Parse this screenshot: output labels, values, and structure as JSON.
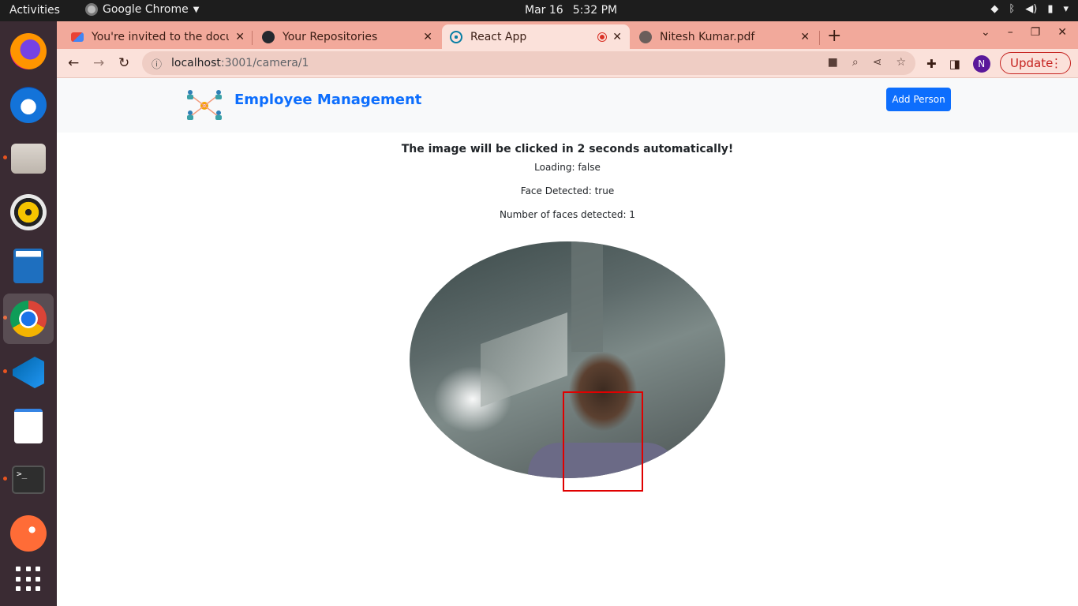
{
  "system": {
    "activities": "Activities",
    "app_name": "Google Chrome",
    "date": "Mar 16",
    "time": "5:32 PM"
  },
  "dock": {
    "apps": [
      "firefox-icon",
      "thunderbird-icon",
      "files-icon",
      "rhythmbox-icon",
      "libreoffice-writer-icon",
      "chrome-icon",
      "vscode-icon",
      "text-editor-icon",
      "terminal-icon",
      "postman-icon",
      "show-apps-icon"
    ]
  },
  "tabs": [
    {
      "title": "You're invited to the docu",
      "favicon": "gmail-icon",
      "active": false
    },
    {
      "title": "Your Repositories",
      "favicon": "github-icon",
      "active": false
    },
    {
      "title": "React App",
      "favicon": "react-icon",
      "active": true
    },
    {
      "title": "Nitesh Kumar.pdf",
      "favicon": "globe-icon",
      "active": false
    }
  ],
  "toolbar": {
    "url_host": "localhost",
    "url_path": ":3001/camera/1",
    "avatar_letter": "N",
    "update_label": "Update"
  },
  "app": {
    "brand": "Employee Management",
    "add_person_label": "Add Person",
    "heading": "The image will be clicked in 2 seconds automatically!",
    "loading_line": "Loading: false",
    "face_detected_line": "Face Detected: true",
    "face_count_line": "Number of faces detected: 1"
  },
  "colors": {
    "brand_blue": "#0d6efd",
    "tab_strip": "#f2a99b",
    "face_box": "#e00000",
    "dock_bg": "#3a2b33"
  }
}
